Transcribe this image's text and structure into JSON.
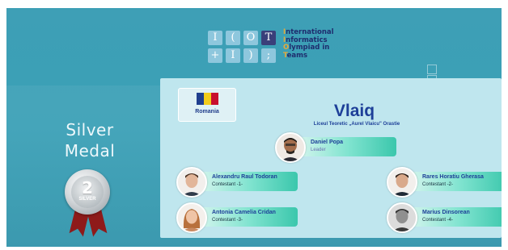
{
  "logo": {
    "tiles_top": [
      "I",
      "(",
      "O",
      "T"
    ],
    "tiles_bottom": [
      "+",
      "I",
      ")",
      ";"
    ],
    "lines": [
      {
        "first": "I",
        "rest": "nternational"
      },
      {
        "first": "I",
        "rest": "nformatics"
      },
      {
        "first": "O",
        "rest": "lympiad in"
      },
      {
        "first": "T",
        "rest": "eams"
      }
    ]
  },
  "medal": {
    "title_line1": "Silver",
    "title_line2": "Medal",
    "number": "2",
    "label": "SILVER"
  },
  "team": {
    "country": "Romania",
    "name": "Vlaiq",
    "school": "Liceul Teoretic „Aurel Vlaicu\" Orastie",
    "flag_colors": [
      "#1f3f8f",
      "#f2cd1b",
      "#c8102e"
    ]
  },
  "members": [
    {
      "name": "Daniel Popa",
      "role": "Leader"
    },
    {
      "name": "Alexandru Raul Todoran",
      "role": "Contestant -1-"
    },
    {
      "name": "Rares Horatiu Gherasa",
      "role": "Contestant -2-"
    },
    {
      "name": "Antonia Camelia Cridan",
      "role": "Contestant -3-"
    },
    {
      "name": "Marius Dinsorean",
      "role": "Contestant -4-"
    }
  ],
  "colors": {
    "background": "#3ea0b6",
    "card": "#bfe6ee",
    "name_text": "#1d3f98",
    "bar_accent": "#3bc7ac",
    "ribbon": "#8e1a1a"
  }
}
